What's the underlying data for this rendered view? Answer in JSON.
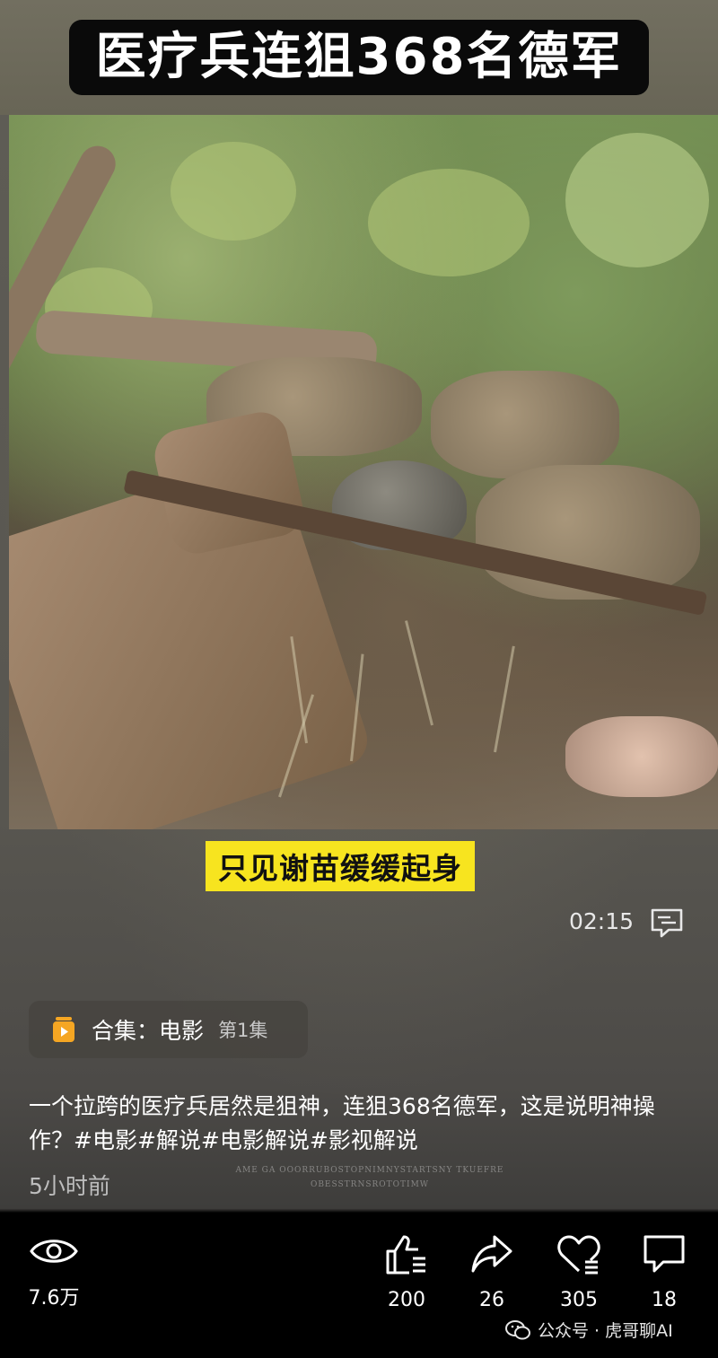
{
  "video": {
    "title_banner": "医疗兵连狙368名德军",
    "caption": "只见谢苗缓缓起身",
    "timestamp": "02:15"
  },
  "collection": {
    "label": "合集：电影",
    "episode": "第1集"
  },
  "post": {
    "description": "一个拉跨的医疗兵居然是狙神，连狙368名德军，这是说明神操作？#电影#解说#电影解说#影视解说",
    "posted_ago": "5小时前"
  },
  "actions": {
    "views": "7.6万",
    "likes": "200",
    "shares": "26",
    "favorites": "305",
    "comments": "18"
  },
  "watermark": {
    "text": "公众号 · 虎哥聊AI"
  },
  "colors": {
    "caption_bg": "#f7e41f",
    "collection_icon": "#f5a623",
    "bar_bg": "#000000"
  }
}
